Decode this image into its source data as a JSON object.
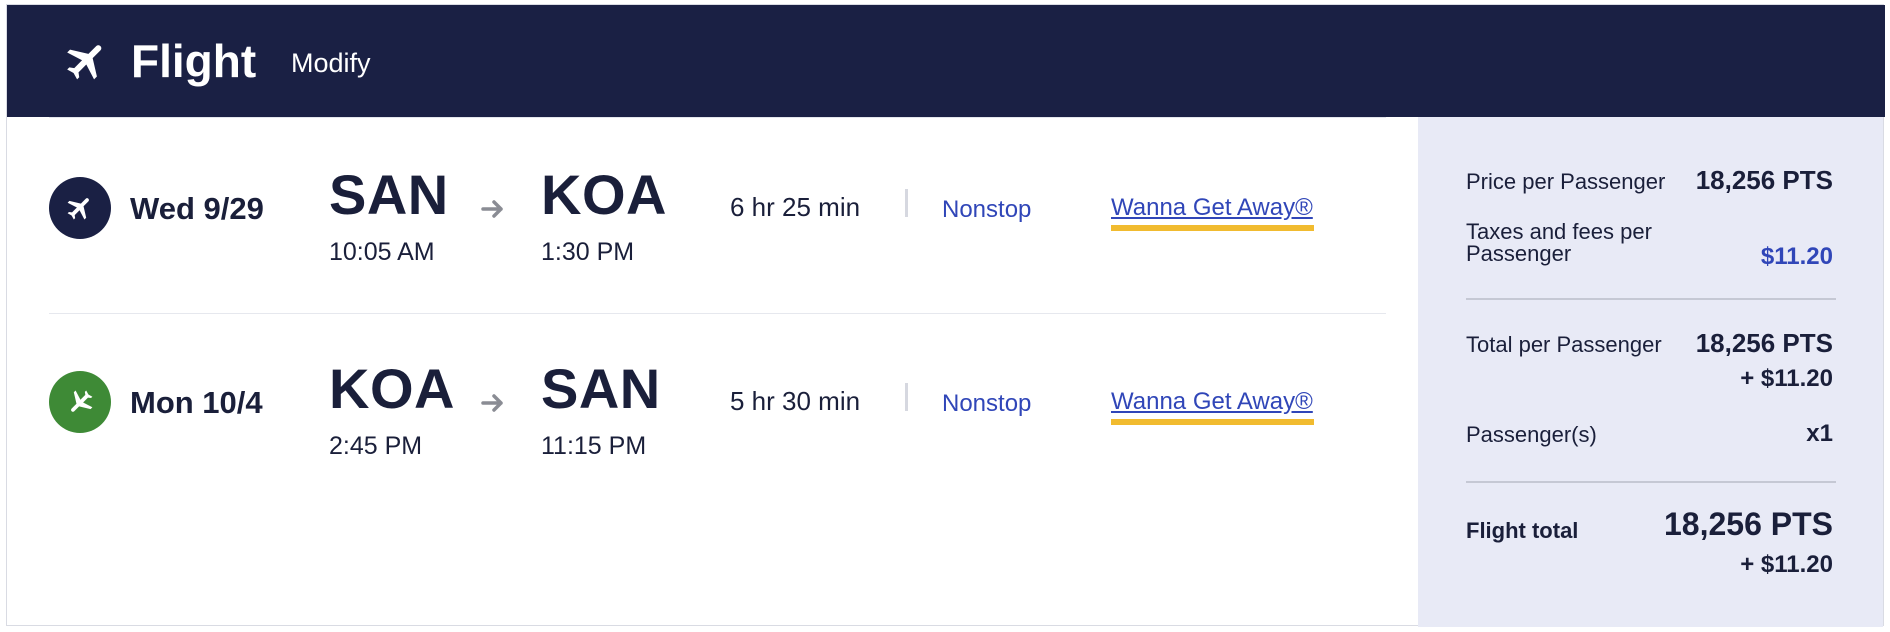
{
  "header": {
    "title": "Flight",
    "modify_label": "Modify",
    "bg_color": "#1a2044"
  },
  "segments": [
    {
      "icon": "airplane-icon",
      "icon_color": "#1a2044",
      "date": "Wed 9/29",
      "from": "SAN",
      "to": "KOA",
      "depart_time": "10:05 AM",
      "arrive_time": "1:30 PM",
      "duration": "6 hr 25 min",
      "stops": "Nonstop",
      "fare": "Wanna Get Away®"
    },
    {
      "icon": "airplane-icon",
      "icon_color": "#3e8a36",
      "date": "Mon 10/4",
      "from": "KOA",
      "to": "SAN",
      "depart_time": "2:45 PM",
      "arrive_time": "11:15 PM",
      "duration": "5 hr 30 min",
      "stops": "Nonstop",
      "fare": "Wanna Get Away®"
    }
  ],
  "summary": {
    "price_label": "Price per Passenger",
    "price_value": "18,256 PTS",
    "taxes_label_line1": "Taxes and fees per",
    "taxes_label_line2": "Passenger",
    "taxes_value": "$11.20",
    "total_label": "Total per Passenger",
    "total_pts": "18,256 PTS",
    "total_cash": "+ $11.20",
    "passengers_label": "Passenger(s)",
    "passengers_value": "x1",
    "flight_total_label": "Flight total",
    "flight_total_pts": "18,256 PTS",
    "flight_total_cash": "+ $11.20",
    "bg_color": "#e8eaf6",
    "accent_color": "#3046b8",
    "fare_underline_color": "#f1bb2f"
  }
}
